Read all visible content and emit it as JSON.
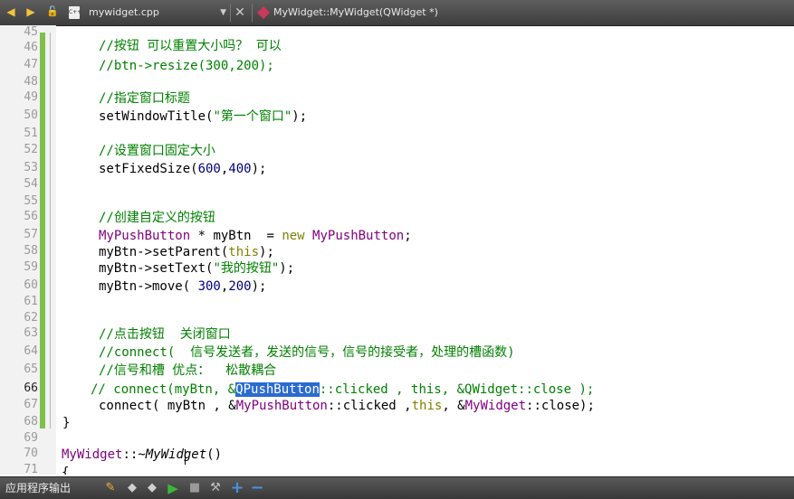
{
  "toolbar": {
    "back_icon": "◀",
    "forward_icon": "▶",
    "lock_icon": "🔓",
    "file_icon_text": "C++",
    "file_name": "mywidget.cpp",
    "dropdown_icon": "▼",
    "close_icon": "✕",
    "function_name": "MyWidget::MyWidget(QWidget *)"
  },
  "editor": {
    "lines": [
      {
        "no": "45"
      },
      {
        "no": "46"
      },
      {
        "no": "47"
      },
      {
        "no": "48"
      },
      {
        "no": "49"
      },
      {
        "no": "50"
      },
      {
        "no": "51"
      },
      {
        "no": "52"
      },
      {
        "no": "53"
      },
      {
        "no": "54"
      },
      {
        "no": "55"
      },
      {
        "no": "56"
      },
      {
        "no": "57"
      },
      {
        "no": "58"
      },
      {
        "no": "59"
      },
      {
        "no": "60"
      },
      {
        "no": "61"
      },
      {
        "no": "62"
      },
      {
        "no": "63"
      },
      {
        "no": "64"
      },
      {
        "no": "65"
      },
      {
        "no": "66"
      },
      {
        "no": "67"
      },
      {
        "no": "68"
      },
      {
        "no": "69"
      },
      {
        "no": "70"
      },
      {
        "no": "71"
      }
    ],
    "t": {
      "l46": "//按钮 可以重置大小吗？ 可以",
      "l47": "//btn->resize(300,200);",
      "l49": "//指定窗口标题",
      "l50a": "setWindowTitle(",
      "l50b": "\"第一个窗口\"",
      "l50c": ");",
      "l52": "//设置窗口固定大小",
      "l53a": "setFixedSize(",
      "l53b": "600",
      "l53c": ",",
      "l53d": "400",
      "l53e": ");",
      "l56": "//创建自定义的按钮",
      "l57a": "MyPushButton",
      "l57b": " * myBtn  = ",
      "l57c": "new",
      "l57d": " ",
      "l57e": "MyPushButton",
      "l57f": ";",
      "l58a": "myBtn->setParent(",
      "l58b": "this",
      "l58c": ");",
      "l59a": "myBtn->setText(",
      "l59b": "\"我的按钮\"",
      "l59c": ");",
      "l60a": "myBtn->move( ",
      "l60b": "300",
      "l60c": ",",
      "l60d": "200",
      "l60e": ");",
      "l63": "//点击按钮  关闭窗口",
      "l64": "//connect(  信号发送者，发送的信号，信号的接受者，处理的槽函数)",
      "l65": "//信号和槽 优点：  松散耦合",
      "l66a": "// connect(myBtn, &",
      "l66b": "QPushButton",
      "l66c": "::clicked , this, &QWidget::close );",
      "l67a": "connect( myBtn , &",
      "l67b": "MyPushButton",
      "l67c": "::clicked ,",
      "l67d": "this",
      "l67e": ", &",
      "l67f": "MyWidget",
      "l67g": "::close);",
      "l68": "}",
      "l70a": "MyWidget",
      "l70b": "::~",
      "l70c": "MyWidget",
      "l70d": "()",
      "l71": "{"
    }
  },
  "bottombar": {
    "label": "应用程序输出",
    "icons": [
      "broom-icon",
      "prev-icon",
      "next-icon",
      "run-icon",
      "stop-icon",
      "settings-icon",
      "zoom-in-icon",
      "zoom-out-icon"
    ],
    "glyphs": [
      "✎",
      "◆",
      "◆",
      "▶",
      "■",
      "⚒",
      "+",
      "−"
    ]
  },
  "colors": {
    "comment": "#008000",
    "keyword": "#808000",
    "type": "#800080",
    "selection": "#2a6bd1",
    "change_marker": "#7ec14a"
  }
}
